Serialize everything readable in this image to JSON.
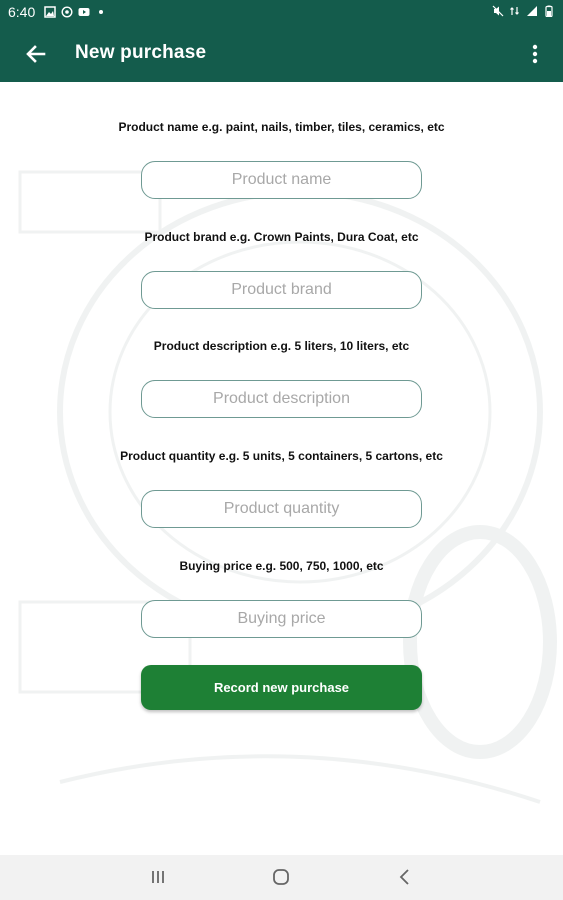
{
  "status_bar": {
    "time": "6:40",
    "left_icons": [
      "image-icon",
      "at-icon",
      "youtube-icon",
      "dot-icon"
    ],
    "right_icons": [
      "mute-icon",
      "network-icon",
      "signal-icon",
      "battery-icon"
    ]
  },
  "app_bar": {
    "title": "New purchase",
    "back_icon": "arrow-back-icon",
    "menu_icon": "more-vert-icon",
    "color": "#145c4c"
  },
  "form": {
    "fields": [
      {
        "label": "Product name e.g. paint, nails, timber, tiles, ceramics, etc",
        "placeholder": "Product name",
        "value": ""
      },
      {
        "label": "Product brand e.g. Crown Paints, Dura Coat, etc",
        "placeholder": "Product brand",
        "value": ""
      },
      {
        "label": "Product description e.g. 5 liters, 10 liters, etc",
        "placeholder": "Product description",
        "value": ""
      },
      {
        "label": "Product quantity e.g. 5 units, 5 containers, 5 cartons, etc",
        "placeholder": "Product quantity",
        "value": ""
      },
      {
        "label": "Buying price e.g. 500, 750, 1000, etc",
        "placeholder": "Buying price",
        "value": ""
      }
    ],
    "submit_label": "Record new purchase",
    "submit_color": "#1e8035"
  },
  "nav_bar": {
    "buttons": [
      "recents-icon",
      "home-icon",
      "back-icon"
    ]
  }
}
